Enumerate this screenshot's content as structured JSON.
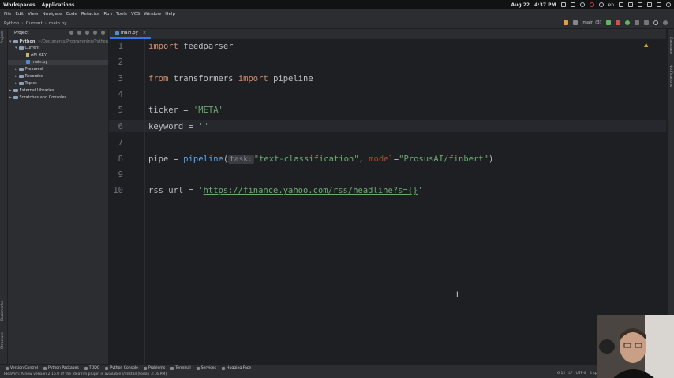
{
  "os_bar": {
    "workspaces": "Workspaces",
    "applications": "Applications",
    "date": "Aug 22",
    "time": "4:37 PM",
    "lang": "en"
  },
  "menu": [
    "File",
    "Edit",
    "View",
    "Navigate",
    "Code",
    "Refactor",
    "Run",
    "Tools",
    "VCS",
    "Window",
    "Help"
  ],
  "nav": {
    "project": "Python",
    "folder": "Current",
    "file": "main.py",
    "branch": "main (3)"
  },
  "project_pane": {
    "title": "Project",
    "root": "Python",
    "root_path": "~/Documents/Programming/Python",
    "items": [
      {
        "label": "Current",
        "indent": 1,
        "kind": "folder",
        "open": true
      },
      {
        "label": "API_KEY",
        "indent": 2,
        "kind": "file"
      },
      {
        "label": "main.py",
        "indent": 2,
        "kind": "py",
        "selected": true
      },
      {
        "label": "Prepared",
        "indent": 1,
        "kind": "folder"
      },
      {
        "label": "Recorded",
        "indent": 1,
        "kind": "folder"
      },
      {
        "label": "Topics",
        "indent": 1,
        "kind": "folder"
      },
      {
        "label": "External Libraries",
        "indent": 0,
        "kind": "lib"
      },
      {
        "label": "Scratches and Consoles",
        "indent": 0,
        "kind": "scratch"
      }
    ]
  },
  "tab": {
    "label": "main.py"
  },
  "code": {
    "line_numbers": [
      "1",
      "2",
      "3",
      "4",
      "5",
      "6",
      "7",
      "8",
      "9",
      "10"
    ],
    "l1_kw": "import",
    "l1_rest": " feedparser",
    "l3_kw1": "from",
    "l3_mid": " transformers ",
    "l3_kw2": "import",
    "l3_rest": " pipeline",
    "l5_a": "ticker = ",
    "l5_str": "'META'",
    "l6_a": "keyword = ",
    "l6_str": "'",
    "l6_str_end": "'",
    "l8_a": "pipe = ",
    "l8_fn": "pipeline",
    "l8_p": "(",
    "l8_hint": "task:",
    "l8_s1": "\"text-classification\"",
    "l8_c": ", ",
    "l8_param": "model",
    "l8_eq": "=",
    "l8_s2": "\"ProsusAI/finbert\"",
    "l8_end": ")",
    "l10_a": "rss_url = ",
    "l10_q1": "'",
    "l10_url": "https://finance.yahoo.com/rss/headline?s={}",
    "l10_q2": "'"
  },
  "left_stripe": [
    "Project",
    "Bookmarks",
    "Structure"
  ],
  "right_stripe": [
    "Database",
    "Notifications"
  ],
  "tool_windows": [
    "Version Control",
    "Python Packages",
    "TODO",
    "Python Console",
    "Problems",
    "Terminal",
    "Services",
    "Hugging Face"
  ],
  "status": {
    "message": "IdeaVim: A new version 2.16.0 of the IdeaVim plugin is available // Install (today 3:16 PM)",
    "position": "6:12",
    "line_sep": "LF",
    "encoding": "UTF-8",
    "indent": "4 spac"
  },
  "colors": {
    "keyword": "#cf8e6d",
    "string": "#6aab73",
    "function": "#56a8f5",
    "editor_bg": "#1e1f22",
    "panel_bg": "#2b2d30",
    "accent": "#3574f0"
  }
}
